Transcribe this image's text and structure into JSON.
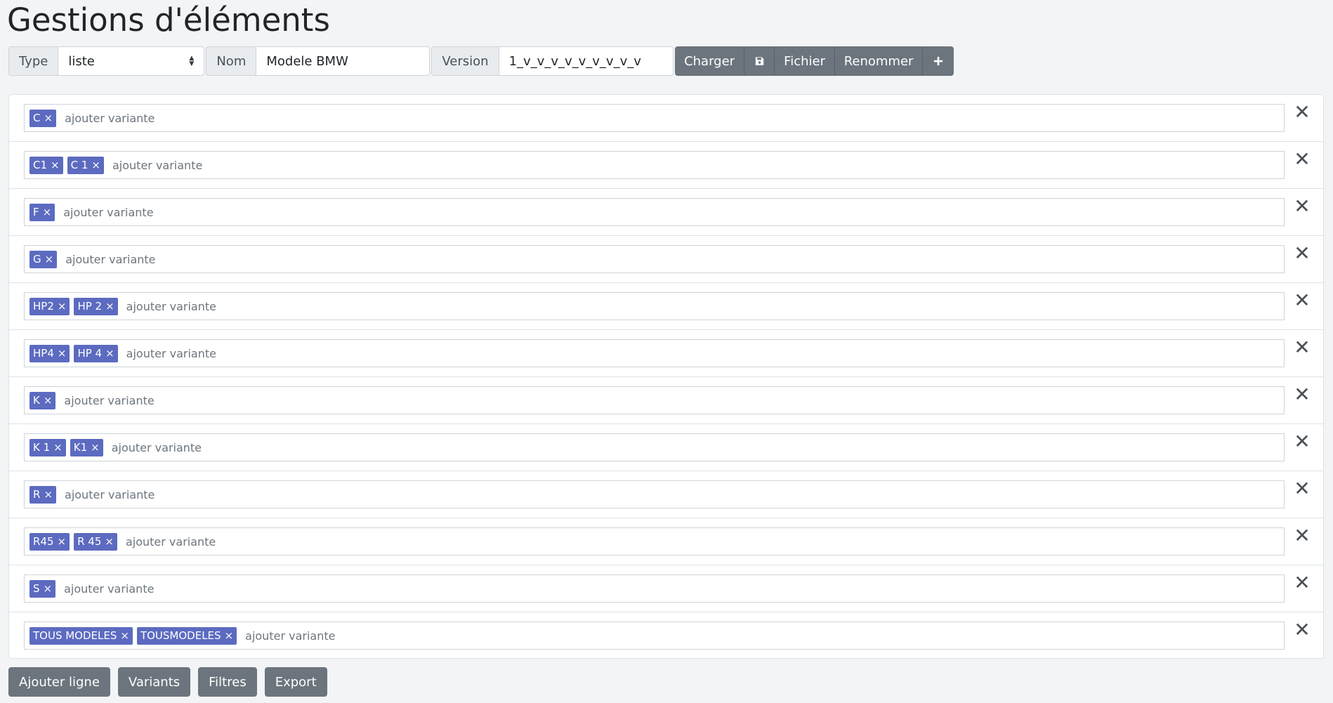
{
  "title": "Gestions d'éléments",
  "toolbar": {
    "type_label": "Type",
    "type_value": "liste",
    "nom_label": "Nom",
    "nom_value": "Modele BMW",
    "version_label": "Version",
    "version_value": "1_v_v_v_v_v_v_v_v_v",
    "charger": "Charger",
    "save_icon": "save-icon",
    "fichier": "Fichier",
    "renommer": "Renommer",
    "add_icon": "plus-icon"
  },
  "placeholder": "ajouter variante",
  "rows": [
    {
      "tags": [
        "C"
      ]
    },
    {
      "tags": [
        "C1",
        "C 1"
      ]
    },
    {
      "tags": [
        "F"
      ]
    },
    {
      "tags": [
        "G"
      ]
    },
    {
      "tags": [
        "HP2",
        "HP 2"
      ]
    },
    {
      "tags": [
        "HP4",
        "HP 4"
      ]
    },
    {
      "tags": [
        "K"
      ]
    },
    {
      "tags": [
        "K 1",
        "K1"
      ]
    },
    {
      "tags": [
        "R"
      ]
    },
    {
      "tags": [
        "R45",
        "R 45"
      ]
    },
    {
      "tags": [
        "S"
      ]
    },
    {
      "tags": [
        "TOUS MODELES",
        "TOUSMODELES"
      ]
    }
  ],
  "tag_remove_glyph": "×",
  "row_remove_glyph": "✕",
  "bottom": {
    "ajouter_ligne": "Ajouter ligne",
    "variants": "Variants",
    "filtres": "Filtres",
    "export": "Export"
  },
  "colors": {
    "tag_bg": "#5c6bc0",
    "button_bg": "#6c757d",
    "page_bg": "#f3f4f6"
  }
}
